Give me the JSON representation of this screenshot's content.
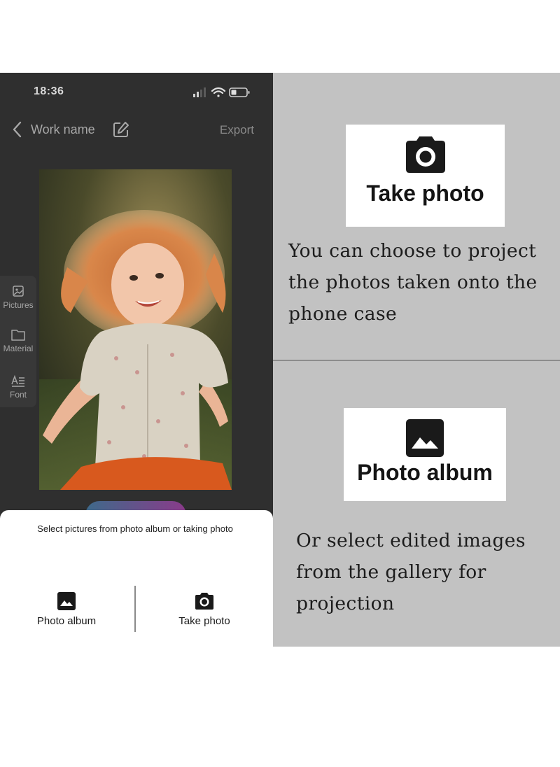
{
  "status_bar": {
    "time": "18:36",
    "icons": [
      "signal-icon",
      "wifi-icon",
      "battery-icon"
    ]
  },
  "nav": {
    "title": "Work name",
    "export_label": "Export",
    "icons": [
      "back-chevron-icon",
      "edit-icon"
    ]
  },
  "side_tools": [
    {
      "label": "Pictures",
      "icon": "pictures-icon"
    },
    {
      "label": "Material",
      "icon": "folder-icon"
    },
    {
      "label": "Font",
      "icon": "font-icon"
    }
  ],
  "sheet": {
    "title": "Select pictures from photo album or taking photo",
    "photo_album_label": "Photo album",
    "take_photo_label": "Take photo"
  },
  "panels": {
    "take_photo": {
      "card_label": "Take photo",
      "icon": "camera-icon",
      "description_lines": [
        "You can choose to project",
        "the photos taken onto the",
        "phone case"
      ]
    },
    "photo_album": {
      "card_label": "Photo album",
      "icon": "image-icon",
      "description_lines": [
        "Or select edited images",
        "from the gallery for",
        "projection"
      ]
    }
  },
  "colors": {
    "phone_background": "#2f2f2f",
    "panel_background": "#c2c2c2",
    "sheet_background": "#ffffff",
    "accent_gradient": [
      "#3e6a8a",
      "#8a3b8a"
    ]
  }
}
